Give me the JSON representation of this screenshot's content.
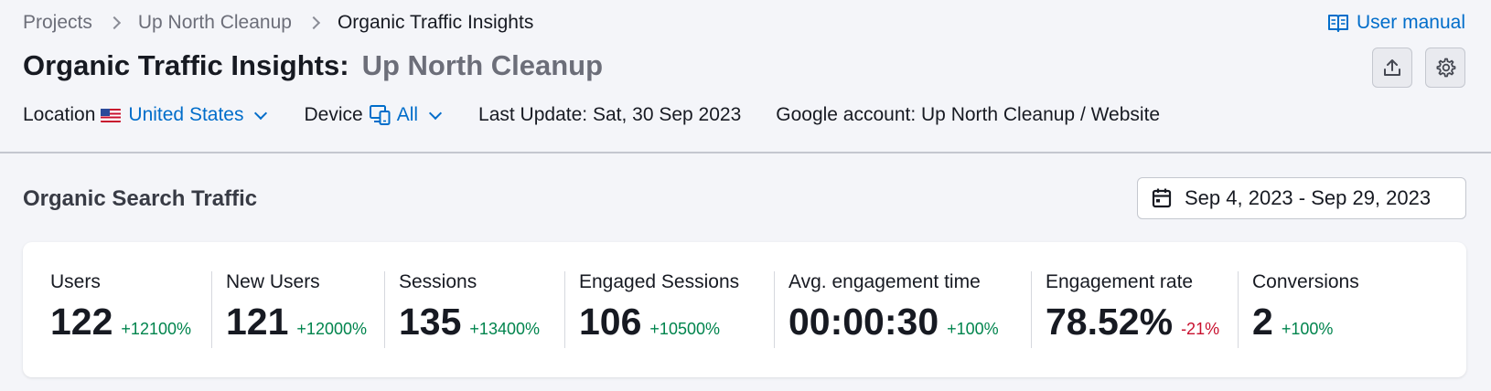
{
  "breadcrumb": {
    "items": [
      "Projects",
      "Up North Cleanup"
    ],
    "current": "Organic Traffic Insights"
  },
  "header": {
    "title": "Organic Traffic Insights:",
    "subtitle": "Up North Cleanup",
    "user_manual": "User manual"
  },
  "filters": {
    "location_label": "Location",
    "location_value": "United States",
    "device_label": "Device",
    "device_value": "All",
    "last_update": "Last Update: Sat, 30 Sep 2023",
    "google_account": "Google account: Up North Cleanup / Website"
  },
  "section": {
    "title": "Organic Search Traffic",
    "date_range": "Sep 4, 2023 - Sep 29, 2023"
  },
  "metrics": [
    {
      "label": "Users",
      "value": "122",
      "delta": "+12100%",
      "trend": "positive"
    },
    {
      "label": "New Users",
      "value": "121",
      "delta": "+12000%",
      "trend": "positive"
    },
    {
      "label": "Sessions",
      "value": "135",
      "delta": "+13400%",
      "trend": "positive"
    },
    {
      "label": "Engaged Sessions",
      "value": "106",
      "delta": "+10500%",
      "trend": "positive"
    },
    {
      "label": "Avg. engagement time",
      "value": "00:00:30",
      "delta": "+100%",
      "trend": "positive"
    },
    {
      "label": "Engagement rate",
      "value": "78.52%",
      "delta": "-21%",
      "trend": "negative"
    },
    {
      "label": "Conversions",
      "value": "2",
      "delta": "+100%",
      "trend": "positive"
    }
  ],
  "colors": {
    "accent": "#006dca",
    "positive": "#00844d",
    "negative": "#c8102e",
    "background": "#f4f5f9"
  },
  "icons": [
    "chevron-right-icon",
    "book-icon",
    "export-icon",
    "gear-icon",
    "us-flag-icon",
    "chevron-down-icon",
    "device-icon",
    "calendar-icon"
  ]
}
